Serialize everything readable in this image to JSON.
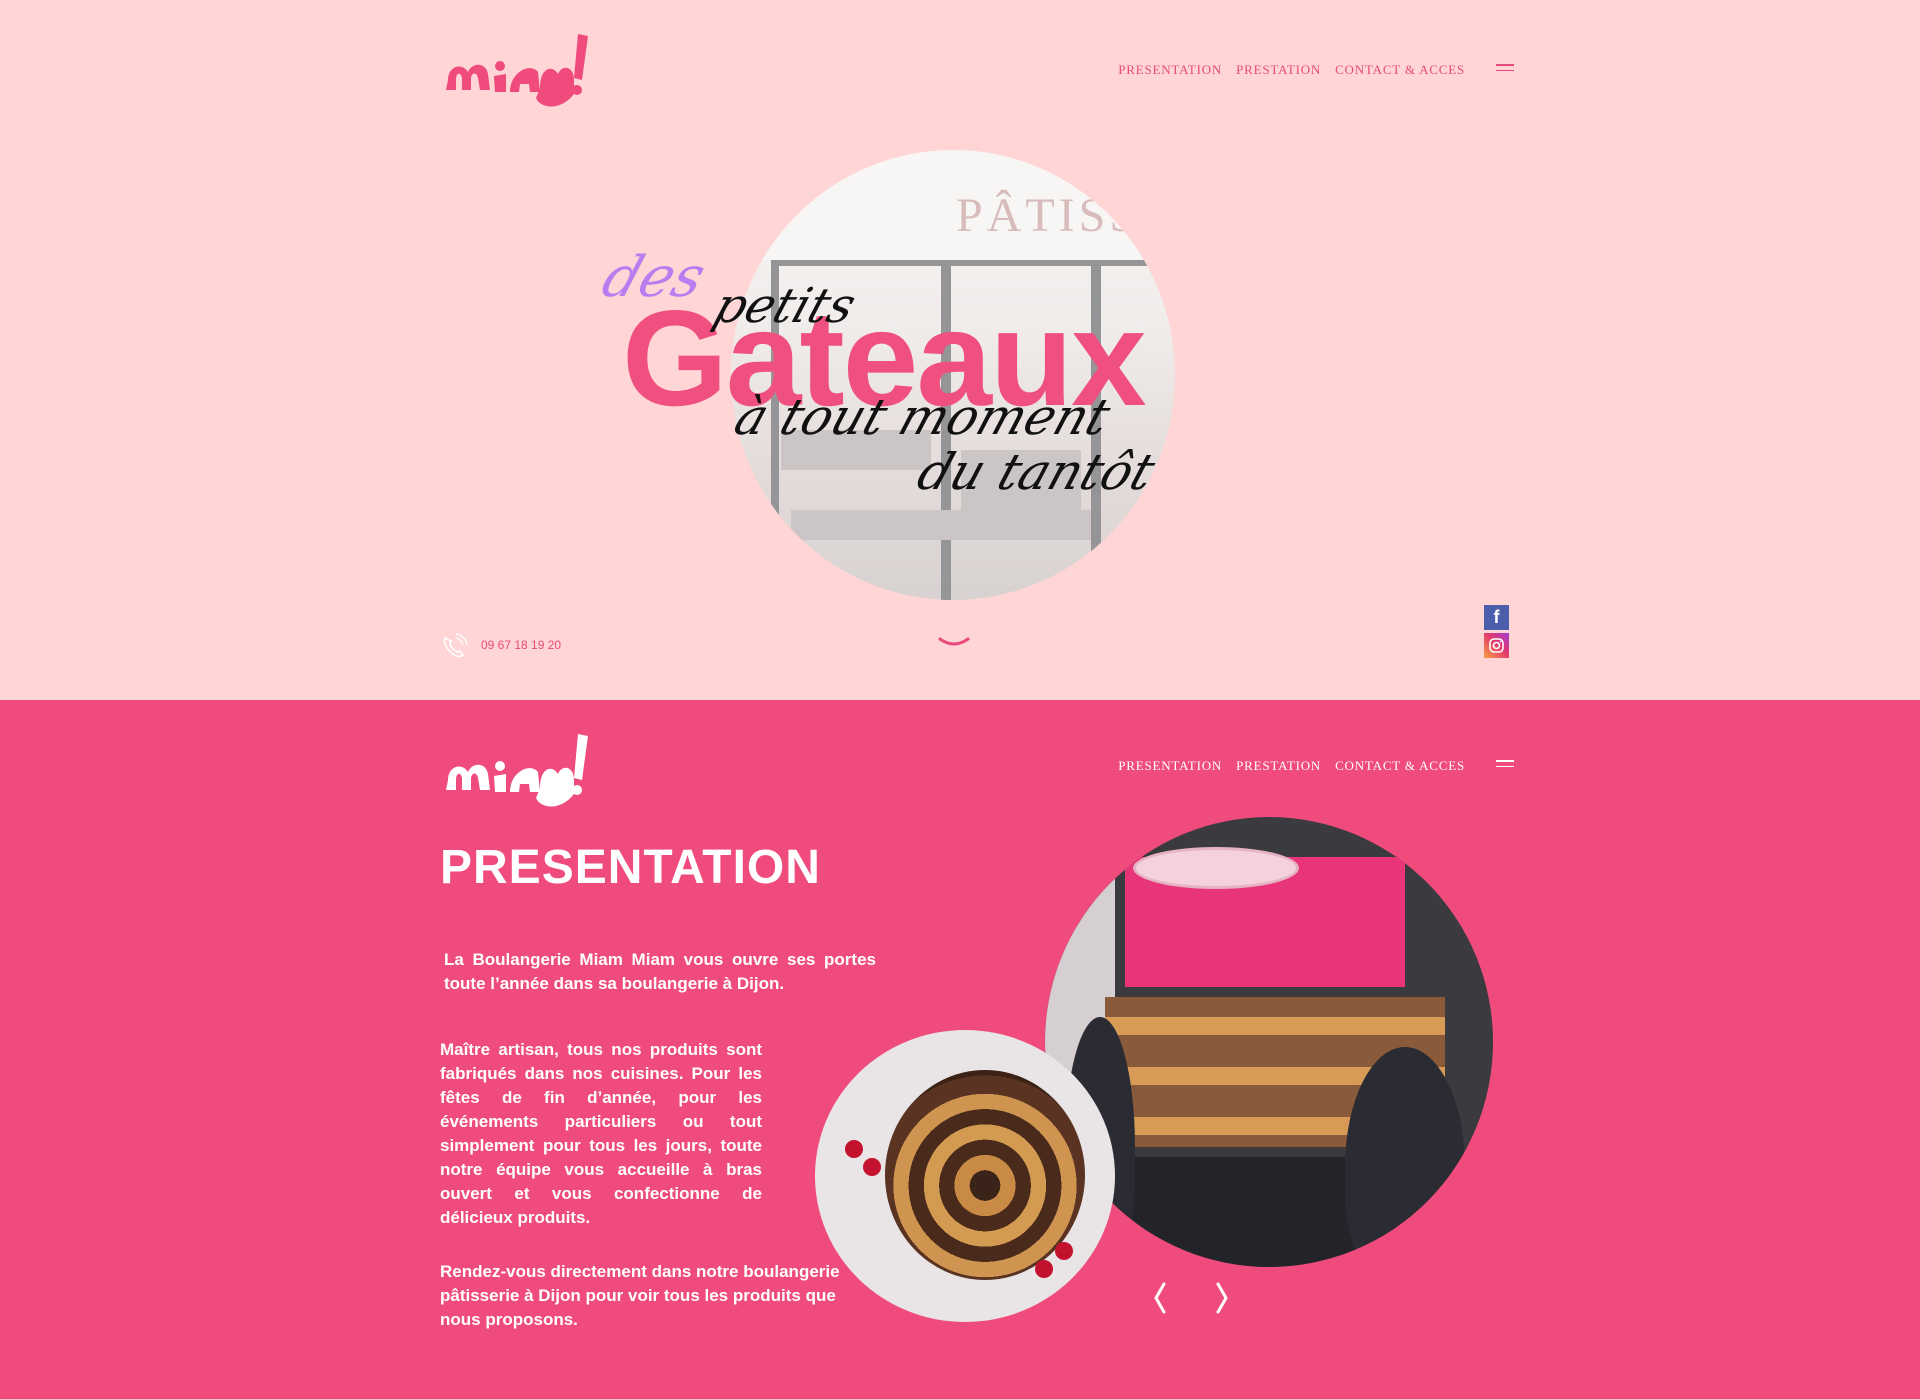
{
  "brand": {
    "logo_text": "miam!"
  },
  "nav": {
    "items": [
      "PRESENTATION",
      "PRESTATION",
      "CONTACT & ACCES"
    ]
  },
  "hero": {
    "headline_des": "des",
    "headline_petits": "petits",
    "headline_main": "Gateaux",
    "headline_tout": "à tout moment",
    "headline_tantot": "du tantôt",
    "image_sign": "PÂTISSE",
    "phone": "09 67 18 19 20"
  },
  "presentation": {
    "title": "PRESENTATION",
    "paragraph1": "La Boulangerie Miam Miam vous ouvre ses portes toute l’année dans sa boulangerie à Dijon.",
    "paragraph2": "Maître artisan, tous nos produits sont fabriqués dans nos cuisines. Pour les fêtes de fin d’année, pour les événements particuliers ou tout simplement pour tous les jours, toute notre équipe vous accueille à bras ouvert et vous confectionne de délicieux produits.",
    "paragraph3": "Rendez-vous directement dans notre boulangerie pâtisserie à Dijon pour voir tous les produits que nous proposons."
  },
  "colors": {
    "hero_bg": "#ffd5d6",
    "accent_pink": "#ef4b7c",
    "purple": "#b97df0"
  },
  "icons": [
    "phone-icon",
    "chevron-down-icon",
    "facebook-icon",
    "instagram-icon",
    "menu-icon",
    "arrow-left-icon",
    "arrow-right-icon"
  ]
}
